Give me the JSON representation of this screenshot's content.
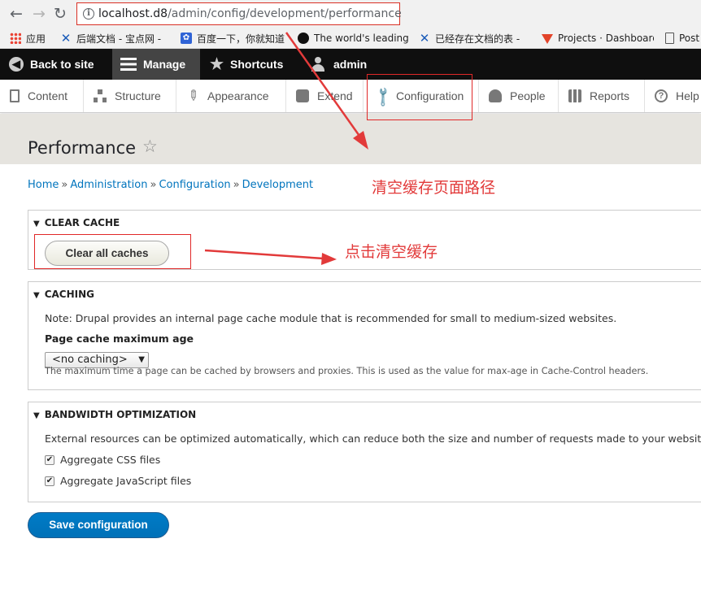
{
  "browser": {
    "url_host": "localhost.d8",
    "url_path": "/admin/config/development/performance",
    "bookmarks": [
      {
        "label": "应用",
        "icon": "apps-grid-icon"
      },
      {
        "label": "后端文档 - 宝点网 - ",
        "icon": "tool-x-icon"
      },
      {
        "label": "百度一下，你就知道",
        "icon": "baidu-paw-icon"
      },
      {
        "label": "The world's leading",
        "icon": "github-icon"
      },
      {
        "label": "已经存在文档的表 - ",
        "icon": "tool-x-icon"
      },
      {
        "label": "Projects · Dashboard",
        "icon": "gitlab-icon"
      },
      {
        "label": "Post",
        "icon": "document-icon"
      }
    ]
  },
  "toolbar": {
    "back_to_site": "Back to site",
    "manage": "Manage",
    "shortcuts": "Shortcuts",
    "user": "admin"
  },
  "tray": {
    "items": [
      "Content",
      "Structure",
      "Appearance",
      "Extend",
      "Configuration",
      "People",
      "Reports",
      "Help"
    ]
  },
  "page": {
    "title": "Performance",
    "breadcrumb": [
      "Home",
      "Administration",
      "Configuration",
      "Development"
    ],
    "breadcrumb_sep": "»"
  },
  "clear_cache": {
    "legend": "CLEAR CACHE",
    "button": "Clear all caches"
  },
  "caching": {
    "legend": "CACHING",
    "note": "Note: Drupal provides an internal page cache module that is recommended for small to medium-sized websites.",
    "max_age_label": "Page cache maximum age",
    "max_age_value": "<no caching>",
    "max_age_desc": "The maximum time a page can be cached by browsers and proxies. This is used as the value for max-age in Cache-Control headers."
  },
  "bandwidth": {
    "legend": "BANDWIDTH OPTIMIZATION",
    "description": "External resources can be optimized automatically, which can reduce both the size and number of requests made to your websit",
    "aggregate_css": {
      "label": "Aggregate CSS files",
      "checked": true
    },
    "aggregate_js": {
      "label": "Aggregate JavaScript files",
      "checked": true
    }
  },
  "actions": {
    "save": "Save configuration"
  },
  "annotations": {
    "path_note": "清空缓存页面路径",
    "click_note": "点击清空缓存",
    "color": "#e23a3a"
  }
}
